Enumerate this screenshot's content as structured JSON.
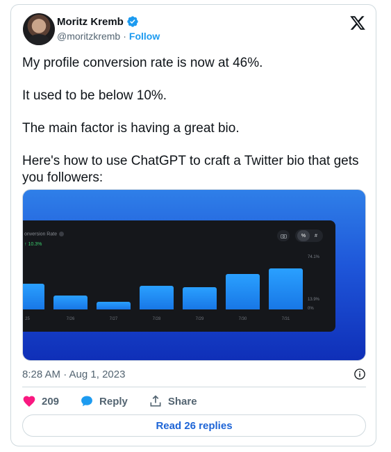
{
  "author": {
    "display_name": "Moritz Kremb",
    "handle": "@moritzkremb",
    "separator": "·",
    "follow_label": "Follow"
  },
  "tweet": {
    "paragraphs": [
      "My profile conversion rate is now at 46%.",
      "It used to be below 10%.",
      "The main factor is having a great bio.",
      "Here's how to use ChatGPT to craft a Twitter bio that gets you followers:"
    ],
    "timestamp": "8:28 AM · Aug 1, 2023"
  },
  "media_chart": {
    "title": "onversion Rate",
    "stat": "↑ 10.3%",
    "toggle_percent": "%",
    "toggle_count": "#",
    "y_top_label": "74.1%",
    "y_mid_label": "13.9%",
    "y_zero_label": "0%",
    "chart_data": {
      "type": "bar",
      "categories": [
        "25",
        "7/26",
        "7/27",
        "7/28",
        "7/29",
        "7/30",
        "7/31"
      ],
      "values": [
        34.3,
        18.3,
        9.8,
        31.8,
        30.0,
        47.6,
        54.4
      ],
      "ylim": [
        0,
        74.1
      ]
    }
  },
  "actions": {
    "like_count": "209",
    "reply_label": "Reply",
    "share_label": "Share"
  },
  "read_replies_label": "Read 26 replies",
  "colors": {
    "accent": "#1d9bf0",
    "like": "#f91880",
    "text_secondary": "#536471"
  }
}
